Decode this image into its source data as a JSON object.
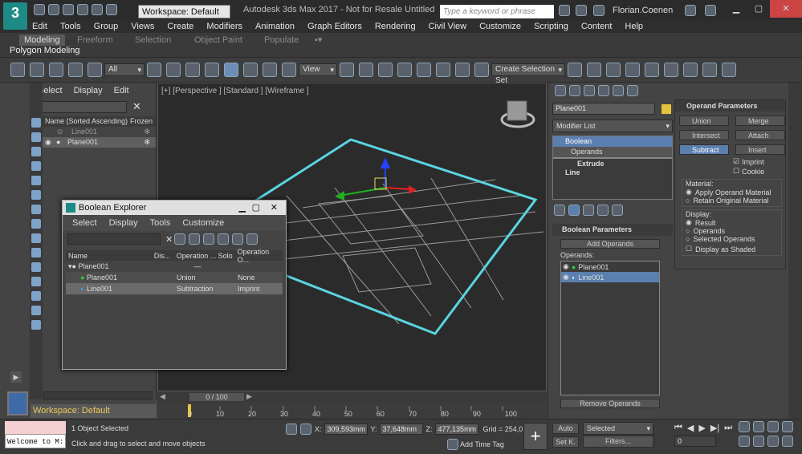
{
  "titlebar": {
    "logo": "3",
    "workspace": "Workspace: Default",
    "title": "Autodesk 3ds Max 2017 - Not for Resale     Untitled",
    "search_placeholder": "Type a keyword or phrase",
    "user": "Florian.Coenen"
  },
  "menu": [
    "Edit",
    "Tools",
    "Group",
    "Views",
    "Create",
    "Modifiers",
    "Animation",
    "Graph Editors",
    "Rendering",
    "Civil View",
    "Customize",
    "Scripting",
    "Content",
    "Help"
  ],
  "ribbon": {
    "tabs": [
      "Modeling",
      "Freeform",
      "Selection",
      "Object Paint",
      "Populate"
    ],
    "panel": "Polygon Modeling"
  },
  "toolbar": {
    "filter": "All",
    "view": "View",
    "selset": "Create Selection Set"
  },
  "scene_explorer": {
    "menu": [
      "Select",
      "Display",
      "Edit"
    ],
    "col_name": "Name (Sorted Ascending)",
    "col_frozen": "Frozen",
    "rows": [
      "Line001",
      "Plane001"
    ]
  },
  "viewport": {
    "label": "[+] [Perspective ] [Standard ] [Wireframe ]"
  },
  "timeline": {
    "slider": "0 / 100",
    "ticks": [
      "0",
      "10",
      "20",
      "30",
      "40",
      "50",
      "60",
      "70",
      "80",
      "90",
      "100"
    ]
  },
  "boolean_explorer": {
    "title": "Boolean Explorer",
    "menu": [
      "Select",
      "Display",
      "Tools",
      "Customize"
    ],
    "cols": [
      "Name",
      "Dis...",
      "Operation ...",
      "Solo",
      "Operation O..."
    ],
    "root": "Plane001",
    "rows": [
      {
        "name": "Plane001",
        "op": "Union",
        "opt": "None",
        "dash": "—"
      },
      {
        "name": "Line001",
        "op": "Subtraction",
        "opt": "Imprint",
        "dash": "—"
      }
    ],
    "root_dash": "—"
  },
  "command_panel": {
    "object_name": "Plane001",
    "modifier_list": "Modifier List",
    "stack": [
      "Boolean",
      "Operands",
      "Extrude",
      "Line"
    ],
    "bool_params": "Boolean Parameters",
    "add_operands": "Add Operands",
    "operands_label": "Operands:",
    "operands": [
      "Plane001",
      "Line001"
    ],
    "remove_operands": "Remove Operands"
  },
  "operand_panel": {
    "title": "Operand Parameters",
    "buttons": [
      "Union",
      "Merge",
      "Intersect",
      "Attach",
      "Subtract",
      "Insert"
    ],
    "imprint": "Imprint",
    "cookie": "Cookie",
    "material_label": "Material:",
    "material_opts": [
      "Apply Operand Material",
      "Retain Original Material"
    ],
    "display_label": "Display:",
    "display_opts": [
      "Result",
      "Operands",
      "Selected Operands"
    ],
    "display_shaded": "Display as Shaded"
  },
  "status": {
    "listener": "Welcome to M:",
    "workspace": "Workspace: Default",
    "selected": "1 Object Selected",
    "hint": "Click and drag to select and move objects",
    "x_label": "X:",
    "x": "309,593mm",
    "y_label": "Y:",
    "y": "37,648mm",
    "z_label": "Z:",
    "z": "477,135mm",
    "grid": "Grid = 254,0mm",
    "add_time_tag": "Add Time Tag",
    "auto": "Auto",
    "selected_drop": "Selected",
    "setk": "Set K.",
    "filters": "Filters...",
    "frame": "0"
  },
  "colors": {
    "accent": "#5b7fae",
    "wire": "#5ad5e0",
    "brand": "#1d8a86"
  }
}
